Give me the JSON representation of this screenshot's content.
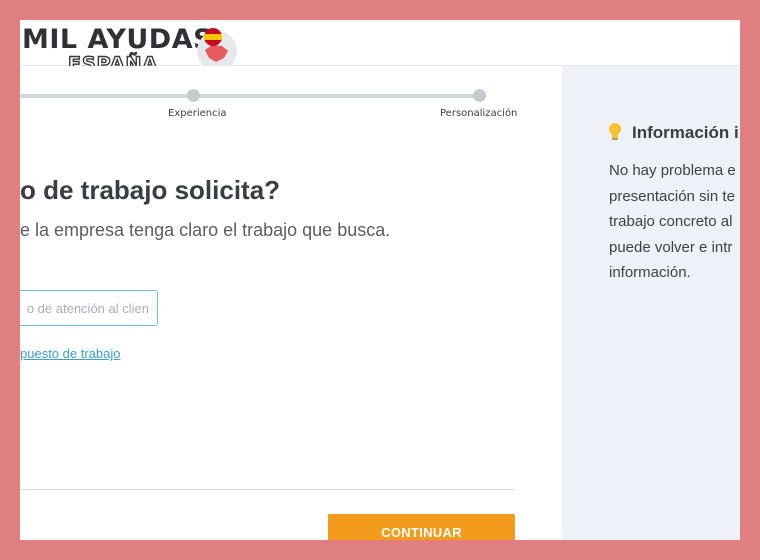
{
  "logo": {
    "main": "MIL AYUDAS",
    "sub": "ESPAÑA"
  },
  "progress": {
    "steps": [
      {
        "label": "Experiencia"
      },
      {
        "label": "Personalización"
      }
    ]
  },
  "question": {
    "title": "o de trabajo solicita?",
    "subtitle": "e la empresa tenga claro el trabajo que busca."
  },
  "job_input": {
    "placeholder": "o de atención al clien"
  },
  "add_job_link": "puesto de trabajo",
  "continue_label": "CONTINUAR",
  "info": {
    "title": "Información i",
    "lines": [
      "No hay problema e",
      "presentación sin te",
      "trabajo concreto al",
      "puede volver e intr",
      "información."
    ]
  },
  "colors": {
    "accent": "#f39b1c",
    "link": "#3b9ed8",
    "sidebar_bg": "#eef2f8",
    "outer_bg": "#df7f7f"
  }
}
